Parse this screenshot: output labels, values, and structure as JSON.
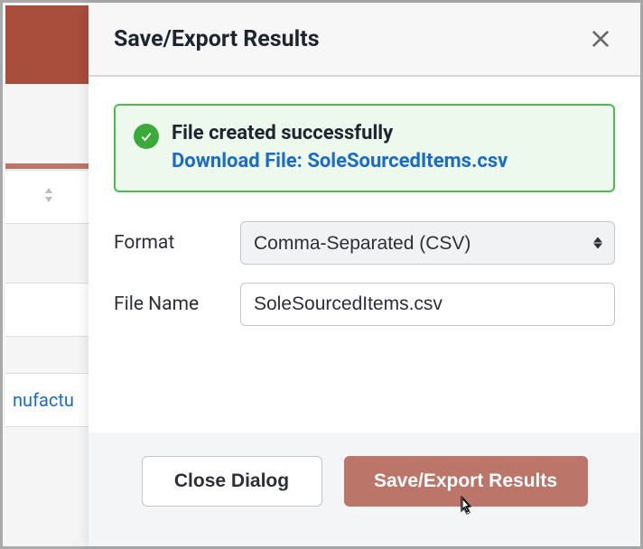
{
  "dialog": {
    "title": "Save/Export Results",
    "success": {
      "message": "File created successfully",
      "download_label": "Download File: SoleSourcedItems.csv"
    },
    "format_label": "Format",
    "format_value": "Comma-Separated (CSV)",
    "filename_label": "File Name",
    "filename_value": "SoleSourcedItems.csv",
    "close_button": "Close Dialog",
    "export_button": "Save/Export Results"
  },
  "background": {
    "link_fragment": "nufactu"
  }
}
